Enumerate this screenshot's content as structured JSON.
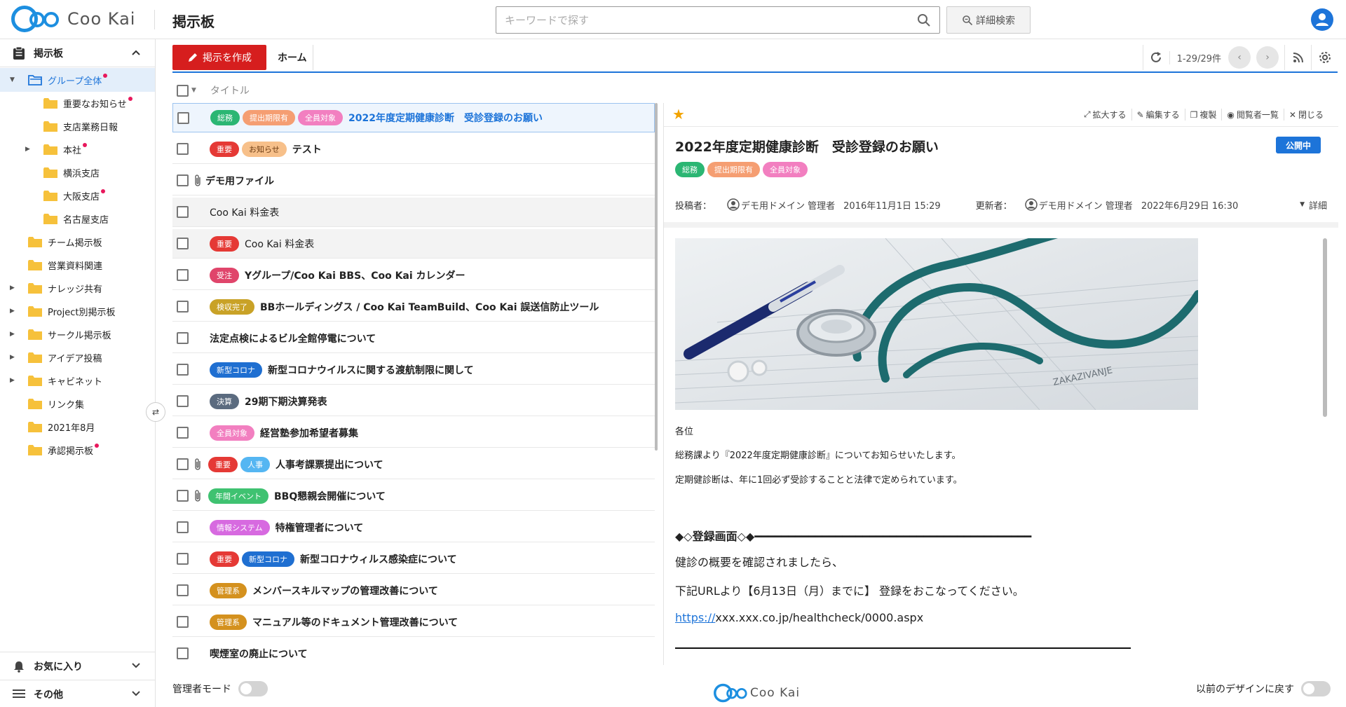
{
  "app": {
    "logo_text": "Coo Kai",
    "page_title": "掲示板",
    "search": {
      "placeholder": "キーワードで探す"
    },
    "advanced_search_label": "詳細検索"
  },
  "sidebar": {
    "header_label": "掲示板",
    "items": [
      {
        "label": "グループ全体",
        "dot": true,
        "selected": true
      },
      {
        "label": "重要なお知らせ",
        "dot": true
      },
      {
        "label": "支店業務日報",
        "dot": false
      },
      {
        "label": "本社",
        "dot": true
      },
      {
        "label": "横浜支店",
        "dot": false
      },
      {
        "label": "大阪支店",
        "dot": true
      },
      {
        "label": "名古屋支店",
        "dot": false
      },
      {
        "label": "チーム掲示板",
        "dot": false
      },
      {
        "label": "営業資料関連",
        "dot": false
      },
      {
        "label": "ナレッジ共有",
        "dot": false
      },
      {
        "label": "Project別掲示板",
        "dot": false
      },
      {
        "label": "サークル掲示板",
        "dot": false
      },
      {
        "label": "アイデア投稿",
        "dot": false
      },
      {
        "label": "キャビネット",
        "dot": false
      },
      {
        "label": "リンク集",
        "dot": false
      },
      {
        "label": "2021年8月",
        "dot": false
      },
      {
        "label": "承認掲示板",
        "dot": true
      }
    ],
    "favorites_label": "お気に入り",
    "other_label": "その他"
  },
  "toolbar": {
    "create_label": "掲示を作成",
    "home_label": "ホーム",
    "pager_text": "1-29/29件"
  },
  "list": {
    "column_title": "タイトル",
    "rows": [
      {
        "title": "2022年度定期健康診断　受診登録のお願い",
        "tags": [
          "総務",
          "提出期限有",
          "全員対象"
        ],
        "clip": false,
        "active": true,
        "bold": true,
        "grey": false
      },
      {
        "title": "テスト",
        "tags": [
          "重要",
          "お知らせ"
        ],
        "clip": false,
        "active": false,
        "bold": true,
        "grey": false
      },
      {
        "title": "デモ用ファイル",
        "tags": [],
        "clip": true,
        "active": false,
        "bold": true,
        "grey": false
      },
      {
        "title": "Coo Kai 料金表",
        "tags": [],
        "clip": false,
        "active": false,
        "bold": false,
        "grey": true
      },
      {
        "title": "Coo Kai 料金表",
        "tags": [
          "重要"
        ],
        "clip": false,
        "active": false,
        "bold": false,
        "grey": true
      },
      {
        "title": "Yグループ/Coo Kai BBS、Coo Kai カレンダー",
        "tags": [
          "受注"
        ],
        "clip": false,
        "active": false,
        "bold": true,
        "grey": false
      },
      {
        "title": "BBホールディングス / Coo Kai TeamBuild、Coo Kai 誤送信防止ツール",
        "tags": [
          "検収完了"
        ],
        "clip": false,
        "active": false,
        "bold": true,
        "grey": false
      },
      {
        "title": "法定点検によるビル全館停電について",
        "tags": [],
        "clip": false,
        "active": false,
        "bold": true,
        "grey": false
      },
      {
        "title": "新型コロナウイルスに関する渡航制限に関して",
        "tags": [
          "新型コロナ"
        ],
        "clip": false,
        "active": false,
        "bold": true,
        "grey": false
      },
      {
        "title": "29期下期決算発表",
        "tags": [
          "決算"
        ],
        "clip": false,
        "active": false,
        "bold": true,
        "grey": false
      },
      {
        "title": "経営塾参加希望者募集",
        "tags": [
          "全員対象"
        ],
        "clip": false,
        "active": false,
        "bold": true,
        "grey": false
      },
      {
        "title": "人事考課票提出について",
        "tags": [
          "重要",
          "人事"
        ],
        "clip": true,
        "active": false,
        "bold": true,
        "grey": false
      },
      {
        "title": "BBQ懇親会開催について",
        "tags": [
          "年間イベント"
        ],
        "clip": true,
        "active": false,
        "bold": true,
        "grey": false
      },
      {
        "title": "特権管理者について",
        "tags": [
          "情報システム"
        ],
        "clip": false,
        "active": false,
        "bold": true,
        "grey": false
      },
      {
        "title": "新型コロナウィルス感染症について",
        "tags": [
          "重要",
          "新型コロナ"
        ],
        "clip": false,
        "active": false,
        "bold": true,
        "grey": false
      },
      {
        "title": "メンバースキルマップの管理改善について",
        "tags": [
          "管理系"
        ],
        "clip": false,
        "active": false,
        "bold": true,
        "grey": false
      },
      {
        "title": "マニュアル等のドキュメント管理改善について",
        "tags": [
          "管理系"
        ],
        "clip": false,
        "active": false,
        "bold": true,
        "grey": false
      },
      {
        "title": "喫煙室の廃止について",
        "tags": [],
        "clip": false,
        "active": false,
        "bold": true,
        "grey": false
      }
    ]
  },
  "tag_colors": {
    "総務": "#2bb673",
    "提出期限有": "#f59e72",
    "全員対象": "#f27fc0",
    "重要": "#e53935",
    "お知らせ": "#f7c08a",
    "受注": "#e0456b",
    "検収完了": "#c9a227",
    "新型コロナ": "#1f6fd1",
    "決算": "#5b6b7f",
    "人事": "#55b6f2",
    "年間イベント": "#3fc271",
    "情報システム": "#d76ae0",
    "管理系": "#d4911e"
  },
  "tag_text_dark": [
    "お知らせ"
  ],
  "detail": {
    "actions": [
      "拡大する",
      "編集する",
      "複製",
      "閲覧者一覧",
      "閉じる"
    ],
    "title": "2022年度定期健康診断　受診登録のお願い",
    "status_badge": "公開中",
    "tags": [
      "総務",
      "提出期限有",
      "全員対象"
    ],
    "poster_label": "投稿者：",
    "poster_name": "デモ用ドメイン 管理者",
    "posted_at": "2016年11月1日 15:29",
    "updater_label": "更新者：",
    "updater_name": "デモ用ドメイン 管理者",
    "updated_at": "2022年6月29日 16:30",
    "more_label": "詳細",
    "body": {
      "greeting": "各位",
      "line1": "総務課より『2022年度定期健康診断』についてお知らせいたします。",
      "line2": "定期健診断は、年に1回必ず受診することと法律で定められています。",
      "section_heading": "◆◇登録画面◇◆━━━━━━━━━━━━━━━━━━━━━━━━━━━━━━━━━━━━━━━━━",
      "para1": "健診の概要を確認されましたら、",
      "para2": "下記URLより【6月13日（月）までに】 登録をおこなってください。",
      "url_scheme": "https://",
      "url_rest": "xxx.xxx.co.jp/healthcheck/0000.aspx"
    }
  },
  "footer": {
    "admin_mode_label": "管理者モード",
    "logo_text": "Coo Kai",
    "prev_design_label": "以前のデザインに戻す"
  }
}
